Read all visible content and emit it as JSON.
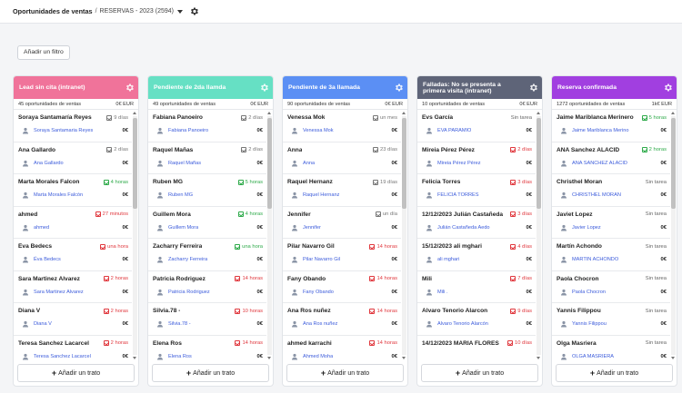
{
  "header": {
    "title": "Oportunidades de ventas",
    "separator": "/",
    "pipeline": "RESERVAS - 2023 (2594)"
  },
  "filter_button": "Añadir un filtro",
  "add_deal_label": "Añadir un trato",
  "columns": [
    {
      "title": "Lead sin cita (intranet)",
      "color": "#f0739a",
      "count": "45 oportunidades de ventas",
      "total": "0€ EUR",
      "cards": [
        {
          "name": "Soraya Santamaría Reyes",
          "tag": "9 días",
          "tag_color": "gray",
          "owner": "Soraya Santamaria Reyes",
          "amount": "0€"
        },
        {
          "name": "Ana Gallardo",
          "tag": "2 días",
          "tag_color": "gray",
          "owner": "Ana Gallardo",
          "amount": "0€"
        },
        {
          "name": "Marta Morales Falcon",
          "tag": "4 horas",
          "tag_color": "green",
          "owner": "Marta Morales Falcón",
          "amount": "0€"
        },
        {
          "name": "ahmed",
          "tag": "27 minutos",
          "tag_color": "red",
          "owner": "ahmed",
          "amount": "0€"
        },
        {
          "name": "Éva Bedecs",
          "tag": "una hora",
          "tag_color": "red",
          "owner": "Éva Bedecs",
          "amount": "0€"
        },
        {
          "name": "Sara Martinez Alvarez",
          "tag": "2 horas",
          "tag_color": "red",
          "owner": "Sara Martinez Alvarez",
          "amount": "0€"
        },
        {
          "name": "Diana V",
          "tag": "2 horas",
          "tag_color": "red",
          "owner": "Diana V",
          "amount": "0€"
        },
        {
          "name": "Teresa Sanchez Lacarcel",
          "tag": "2 horas",
          "tag_color": "red",
          "owner": "Teresa Sanchez Lacarcel",
          "amount": "0€"
        }
      ]
    },
    {
      "title": "Pendiente de 2da llamda",
      "color": "#66e0c4",
      "count": "49 oportunidades de ventas",
      "total": "0€ EUR",
      "cards": [
        {
          "name": "Fabiana Panoeiro",
          "tag": "2 días",
          "tag_color": "gray",
          "owner": "Fabiana Panoeiro",
          "amount": "0€"
        },
        {
          "name": "Raquel Mañas",
          "tag": "2 días",
          "tag_color": "gray",
          "owner": "Raquel Mañas",
          "amount": "0€"
        },
        {
          "name": "Ruben MG",
          "tag": "5 horas",
          "tag_color": "green",
          "owner": "Ruben MG",
          "amount": "0€"
        },
        {
          "name": "Guillem Mora",
          "tag": "4 horas",
          "tag_color": "green",
          "owner": "Guillem Mora",
          "amount": "0€"
        },
        {
          "name": "Zacharry Ferreira",
          "tag": "una hora",
          "tag_color": "green",
          "owner": "Zacharry Ferreira",
          "amount": "0€"
        },
        {
          "name": "Patricia Rodriguez",
          "tag": "14 horas",
          "tag_color": "red",
          "owner": "Patricia Rodriguez",
          "amount": "0€"
        },
        {
          "name": "Silvia.78 -",
          "tag": "10 horas",
          "tag_color": "red",
          "owner": "Silvia.78 -",
          "amount": "0€"
        },
        {
          "name": "Elena Ros",
          "tag": "14 horas",
          "tag_color": "red",
          "owner": "Elena Ros",
          "amount": "0€"
        }
      ]
    },
    {
      "title": "Pendiente de 3a llamada",
      "color": "#5b8ff4",
      "count": "90 oportunidades de ventas",
      "total": "0€ EUR",
      "cards": [
        {
          "name": "Venessa Mok",
          "tag": "un mes",
          "tag_color": "gray",
          "owner": "Venessa Mok",
          "amount": "0€"
        },
        {
          "name": "Anna",
          "tag": "23 días",
          "tag_color": "gray",
          "owner": "Anna",
          "amount": "0€"
        },
        {
          "name": "Raquel Hernanz",
          "tag": "19 días",
          "tag_color": "gray",
          "owner": "Raquel Hernanz",
          "amount": "0€"
        },
        {
          "name": "Jennifer",
          "tag": "un día",
          "tag_color": "gray",
          "owner": "Jennifer",
          "amount": "0€"
        },
        {
          "name": "Pilar Navarro Gil",
          "tag": "14 horas",
          "tag_color": "red",
          "owner": "Pilar Navarro Gil",
          "amount": "0€"
        },
        {
          "name": "Fany Obando",
          "tag": "14 horas",
          "tag_color": "red",
          "owner": "Fany Obando",
          "amount": "0€"
        },
        {
          "name": "Ana Ros nuñez",
          "tag": "14 horas",
          "tag_color": "red",
          "owner": "Ana Ros nuñez",
          "amount": "0€"
        },
        {
          "name": "ahmed karrachi",
          "tag": "14 horas",
          "tag_color": "red",
          "owner": "Ahmed Moha",
          "amount": "0€"
        }
      ]
    },
    {
      "title": "Falladas: No se presenta a primera visita (intranet)",
      "color": "#5e6478",
      "count": "10 oportunidades de ventas",
      "total": "0€ EUR",
      "cards": [
        {
          "name": "Evs García",
          "tag": "Sin tarea",
          "tag_color": "plain",
          "owner": "EVA PARAMIO",
          "amount": "0€"
        },
        {
          "name": "Mireia Pérez Pérez",
          "tag": "2 días",
          "tag_color": "red",
          "owner": "Mireia Pérez Pérez",
          "amount": "0€"
        },
        {
          "name": "Felicia Torres",
          "tag": "3 días",
          "tag_color": "red",
          "owner": "FELICIA TORRES",
          "amount": "0€"
        },
        {
          "name": "12/12/2023 Julián Castañeda",
          "tag": "3 días",
          "tag_color": "red",
          "owner": "Julián Castañeda Aedo",
          "amount": "0€"
        },
        {
          "name": "15/12/2023 ali mghari",
          "tag": "4 días",
          "tag_color": "red",
          "owner": "ali mghari",
          "amount": "0€"
        },
        {
          "name": "Mili",
          "tag": "7 días",
          "tag_color": "red",
          "owner": "Mili .",
          "amount": "0€"
        },
        {
          "name": "Alvaro Tenorio Alarcon",
          "tag": "9 días",
          "tag_color": "red",
          "owner": "Alvaro Tenorio Alarcón",
          "amount": "0€"
        },
        {
          "name": "14/12/2023 MARIA FLORES",
          "tag": "10 días",
          "tag_color": "red",
          "owner": "",
          "amount": ""
        }
      ]
    },
    {
      "title": "Reserva confirmada",
      "color": "#a13fe0",
      "count": "1272 oportunidades de ventas",
      "total": "1k€ EUR",
      "cards": [
        {
          "name": "Jaime Mariblanca Merinero",
          "tag": "5 horas",
          "tag_color": "green",
          "owner": "Jaime Mariblanca Merino",
          "amount": "0€"
        },
        {
          "name": "ANA Sanchez ALACID",
          "tag": "2 horas",
          "tag_color": "green",
          "owner": "ANA SANCHEZ ALACID",
          "amount": "0€"
        },
        {
          "name": "Christhel Moran",
          "tag": "Sin tarea",
          "tag_color": "plain",
          "owner": "CHRISTHEL MORAN",
          "amount": "0€"
        },
        {
          "name": "Javiet Lopez",
          "tag": "Sin tarea",
          "tag_color": "plain",
          "owner": "Javier Lopez",
          "amount": "0€"
        },
        {
          "name": "Martín Achondo",
          "tag": "Sin tarea",
          "tag_color": "plain",
          "owner": "MARTIN ACHONDO",
          "amount": "0€"
        },
        {
          "name": "Paola Chocron",
          "tag": "Sin tarea",
          "tag_color": "plain",
          "owner": "Paola Chocron",
          "amount": "0€"
        },
        {
          "name": "Yannis Filippou",
          "tag": "Sin tarea",
          "tag_color": "plain",
          "owner": "Yannis Filippou",
          "amount": "0€"
        },
        {
          "name": "Olga Masriera",
          "tag": "Sin tarea",
          "tag_color": "plain",
          "owner": "OLGA MASRIERA",
          "amount": "0€"
        }
      ]
    }
  ]
}
